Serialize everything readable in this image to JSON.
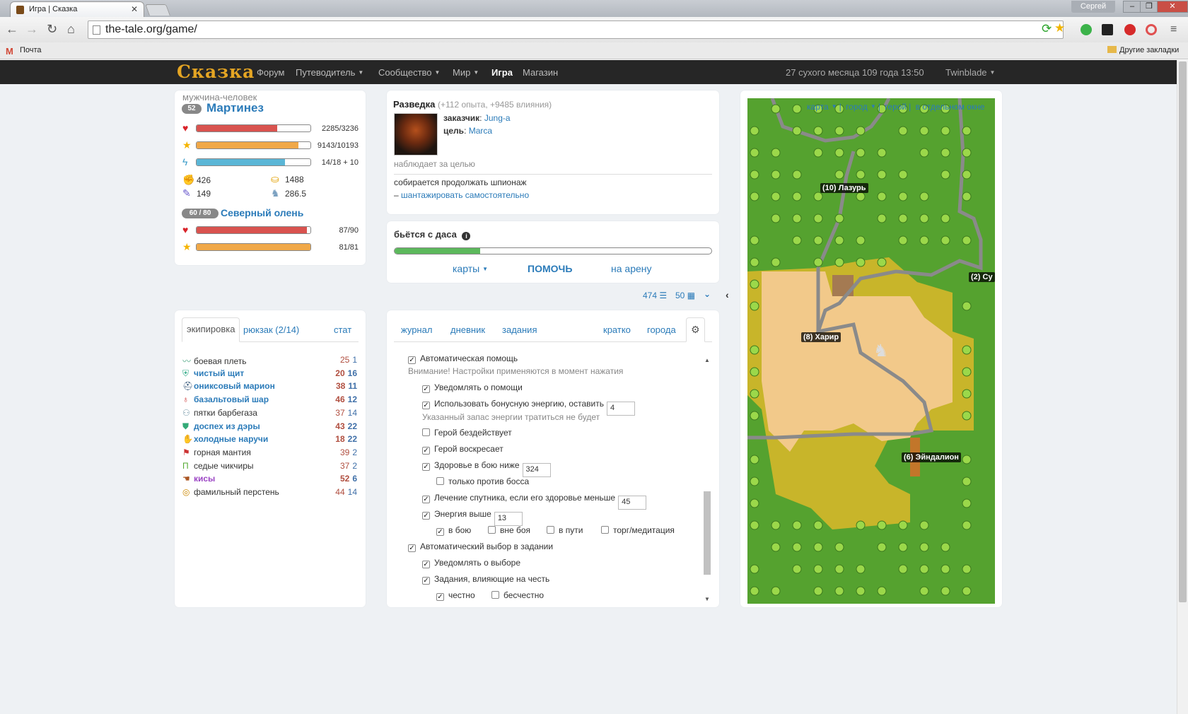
{
  "browser": {
    "tab_title": "Игра | Сказка",
    "user": "Сергей",
    "url": "the-tale.org/game/",
    "bookmark_mail": "Почта",
    "bookmark_other": "Другие закладки"
  },
  "site": {
    "logo": "Сказка",
    "menu": [
      {
        "label": "Форум",
        "dropdown": false
      },
      {
        "label": "Путеводитель",
        "dropdown": true
      },
      {
        "label": "Сообщество",
        "dropdown": true
      },
      {
        "label": "Мир",
        "dropdown": true
      },
      {
        "label": "Игра",
        "dropdown": false,
        "active": true
      },
      {
        "label": "Магазин",
        "dropdown": false
      }
    ],
    "game_date": "27 сухого месяца 109 года 13:50",
    "username": "Twinblade"
  },
  "hero": {
    "race": "мужчина-человек",
    "level": "52",
    "name": "Мартинез",
    "health": {
      "text": "2285/3236",
      "frac": 0.706
    },
    "experience": {
      "text": "9143/10193",
      "frac": 0.897
    },
    "energy": {
      "text": "14/18 + 10",
      "frac": 0.778
    },
    "power_physic": "426",
    "gold": "1488",
    "power_magic": "149",
    "move_speed": "286.5",
    "companion": {
      "level": "60 / 80",
      "name": "Северный олень",
      "health": {
        "text": "87/90",
        "frac": 0.967
      },
      "experience": {
        "text": "81/81",
        "frac": 1.0
      }
    }
  },
  "quest": {
    "title": "Разведка",
    "reward": "(+112 опыта, +9485 влияния)",
    "client_label": "заказчик",
    "client": "Jung-a",
    "target_label": "цель",
    "target": "Marca",
    "observe": "наблюдает за целью",
    "action": "собирается продолжать шпионаж",
    "choice_prefix": "– ",
    "choice": "шантажировать самостоятельно"
  },
  "fight": {
    "title": "бьётся с даса",
    "progress": 0.27,
    "cards": "карты",
    "help": "ПОМОЧЬ",
    "arena": "на арену",
    "count_a": "474",
    "count_b": "50"
  },
  "equipment_tabs": {
    "equipment": "экипировка",
    "bag": "рюкзак (2/14)",
    "stats": "стат"
  },
  "equipment": [
    {
      "icon": "whip-icon",
      "name": "боевая плеть",
      "phys": "25",
      "mag": "1",
      "style": ""
    },
    {
      "icon": "shield-icon",
      "name": "чистый щит",
      "phys": "20",
      "mag": "16",
      "style": "b"
    },
    {
      "icon": "helmet-icon",
      "name": "ониксовый марион",
      "phys": "38",
      "mag": "11",
      "style": "b"
    },
    {
      "icon": "amulet-icon",
      "name": "базальтовый шар",
      "phys": "46",
      "mag": "12",
      "style": "b"
    },
    {
      "icon": "boots-icon",
      "name": "пятки барбегаза",
      "phys": "37",
      "mag": "14",
      "style": ""
    },
    {
      "icon": "armor-icon",
      "name": "доспех из дэры",
      "phys": "43",
      "mag": "22",
      "style": "b"
    },
    {
      "icon": "gloves-icon",
      "name": "холодные наручи",
      "phys": "18",
      "mag": "22",
      "style": "b"
    },
    {
      "icon": "cloak-icon",
      "name": "горная мантия",
      "phys": "39",
      "mag": "2",
      "style": ""
    },
    {
      "icon": "pants-icon",
      "name": "седые чикчиры",
      "phys": "37",
      "mag": "2",
      "style": ""
    },
    {
      "icon": "hands-icon",
      "name": "кисы",
      "phys": "52",
      "mag": "6",
      "style": "p"
    },
    {
      "icon": "ring-icon",
      "name": "фамильный перстень",
      "phys": "44",
      "mag": "14",
      "style": ""
    }
  ],
  "journal_tabs": {
    "journal": "журнал",
    "diary": "дневник",
    "quests": "задания",
    "brief": "кратко",
    "cities": "города"
  },
  "settings": {
    "auto_help": "Автоматическая помощь",
    "notice": "Внимание! Настройки применяются в момент нажатия",
    "notify_help": "Уведомлять о помощи",
    "use_bonus": "Использовать бонусную энергию, оставить",
    "use_bonus_value": "4",
    "bonus_note": "Указанный запас энергии тратиться не будет",
    "idle": "Герой бездействует",
    "resurrect": "Герой воскресает",
    "health_below": "Здоровье в бою ниже",
    "health_below_value": "324",
    "only_boss": "только против босса",
    "heal_companion": "Лечение спутника, если его здоровье меньше",
    "heal_companion_value": "45",
    "energy_above": "Энергия выше",
    "energy_above_value": "13",
    "in_battle": "в бою",
    "out_battle": "вне боя",
    "on_road": "в пути",
    "trade": "торг/медитация",
    "auto_choice": "Автоматический выбор в задании",
    "notify_choice": "Уведомлять о выборе",
    "honor_quests": "Задания, влияющие на честь",
    "honest": "честно",
    "dishonest": "бесчестно"
  },
  "map": {
    "links": {
      "map": "карта",
      "city": "город",
      "hero": "герой",
      "separate": "в отдельном окне"
    },
    "cities": [
      {
        "label": "(10) Лазурь"
      },
      {
        "label": "(8) Харир"
      },
      {
        "label": "(6) Эйндалион"
      },
      {
        "label": "(2) Су"
      }
    ]
  },
  "colors": {
    "accent": "#2b7bb9",
    "health": "#d9534f",
    "experience": "#f0a848",
    "energy": "#5bb6d6",
    "fight": "#5cb85c",
    "nav_bg": "#262626"
  }
}
